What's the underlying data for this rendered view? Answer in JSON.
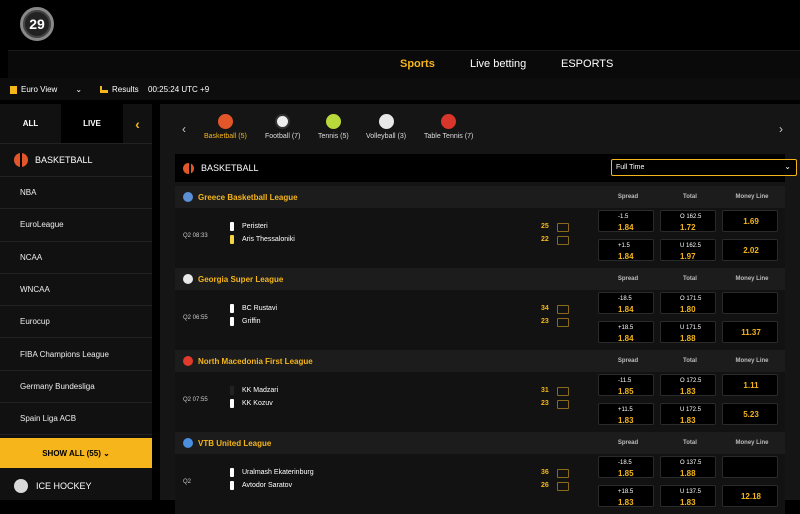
{
  "logo": {
    "text": "29"
  },
  "nav": {
    "sports": "Sports",
    "live_betting": "Live betting",
    "esports": "ESPORTS"
  },
  "info": {
    "view": "Euro View",
    "results": "Results",
    "time": "00:25:24 UTC +9"
  },
  "sidebar": {
    "tab_all": "ALL",
    "tab_live": "LIVE",
    "collapse": "‹",
    "header": "BASKETBALL",
    "items": [
      "NBA",
      "EuroLeague",
      "NCAA",
      "WNCAA",
      "Eurocup",
      "FIBA Champions League",
      "Germany Bundesliga",
      "Spain Liga ACB"
    ],
    "show_all": "SHOW ALL (55) ⌄",
    "ice_hockey": "ICE HOCKEY"
  },
  "sports": [
    {
      "label": "Basketball (5)",
      "color": "#e2562a"
    },
    {
      "label": "Football (7)",
      "color": "#eeeeee"
    },
    {
      "label": "Tennis (5)",
      "color": "#b9d83a"
    },
    {
      "label": "Volleyball (3)",
      "color": "#e8e8e8"
    },
    {
      "label": "Table Tennis (7)",
      "color": "#d8362a"
    }
  ],
  "section": {
    "title": "BASKETBALL",
    "period": "Full Time"
  },
  "columns": {
    "spread": "Spread",
    "total": "Total",
    "moneyline": "Money Line"
  },
  "leagues": [
    {
      "name": "Greece Basketball League",
      "flag": "#5b8fd6",
      "time": "Q2  08:33",
      "teams": [
        {
          "name": "Peristeri",
          "score": "25",
          "shirt": "#ffffff"
        },
        {
          "name": "Aris Thessaloniki",
          "score": "22",
          "shirt": "#f5d442"
        }
      ],
      "spread": [
        {
          "line": "-1.5",
          "price": "1.84"
        },
        {
          "line": "+1.5",
          "price": "1.84"
        }
      ],
      "total": [
        {
          "line": "O  162.5",
          "price": "1.72"
        },
        {
          "line": "U  162.5",
          "price": "1.97"
        }
      ],
      "moneyline": [
        "1.69",
        "2.02"
      ]
    },
    {
      "name": "Georgia Super League",
      "flag": "#e8e8e8",
      "time": "Q2  06:55",
      "teams": [
        {
          "name": "BC Rustavi",
          "score": "34",
          "shirt": "#ffffff"
        },
        {
          "name": "Griffin",
          "score": "23",
          "shirt": "#ffffff"
        }
      ],
      "spread": [
        {
          "line": "-18.5",
          "price": "1.84"
        },
        {
          "line": "+18.5",
          "price": "1.84"
        }
      ],
      "total": [
        {
          "line": "O  171.5",
          "price": "1.80"
        },
        {
          "line": "U  171.5",
          "price": "1.88"
        }
      ],
      "moneyline": [
        "",
        "11.37"
      ]
    },
    {
      "name": "North Macedonia First League",
      "flag": "#e03b2b",
      "time": "Q2  07:55",
      "teams": [
        {
          "name": "KK Madzari",
          "score": "31",
          "shirt": "#222222"
        },
        {
          "name": "KK Kozuv",
          "score": "23",
          "shirt": "#ffffff"
        }
      ],
      "spread": [
        {
          "line": "-11.5",
          "price": "1.85"
        },
        {
          "line": "+11.5",
          "price": "1.83"
        }
      ],
      "total": [
        {
          "line": "O  172.5",
          "price": "1.83"
        },
        {
          "line": "U  172.5",
          "price": "1.83"
        }
      ],
      "moneyline": [
        "1.11",
        "5.23"
      ]
    },
    {
      "name": "VTB United League",
      "flag": "#4a8fe0",
      "time": "Q2",
      "teams": [
        {
          "name": "Uralmash Ekaterinburg",
          "score": "36",
          "shirt": "#ffffff"
        },
        {
          "name": "Avtodor Saratov",
          "score": "26",
          "shirt": "#ffffff"
        }
      ],
      "spread": [
        {
          "line": "-18.5",
          "price": "1.85"
        },
        {
          "line": "+18.5",
          "price": "1.83"
        }
      ],
      "total": [
        {
          "line": "O  137.5",
          "price": "1.88"
        },
        {
          "line": "U  137.5",
          "price": "1.83"
        }
      ],
      "moneyline": [
        "",
        "12.18"
      ]
    }
  ]
}
